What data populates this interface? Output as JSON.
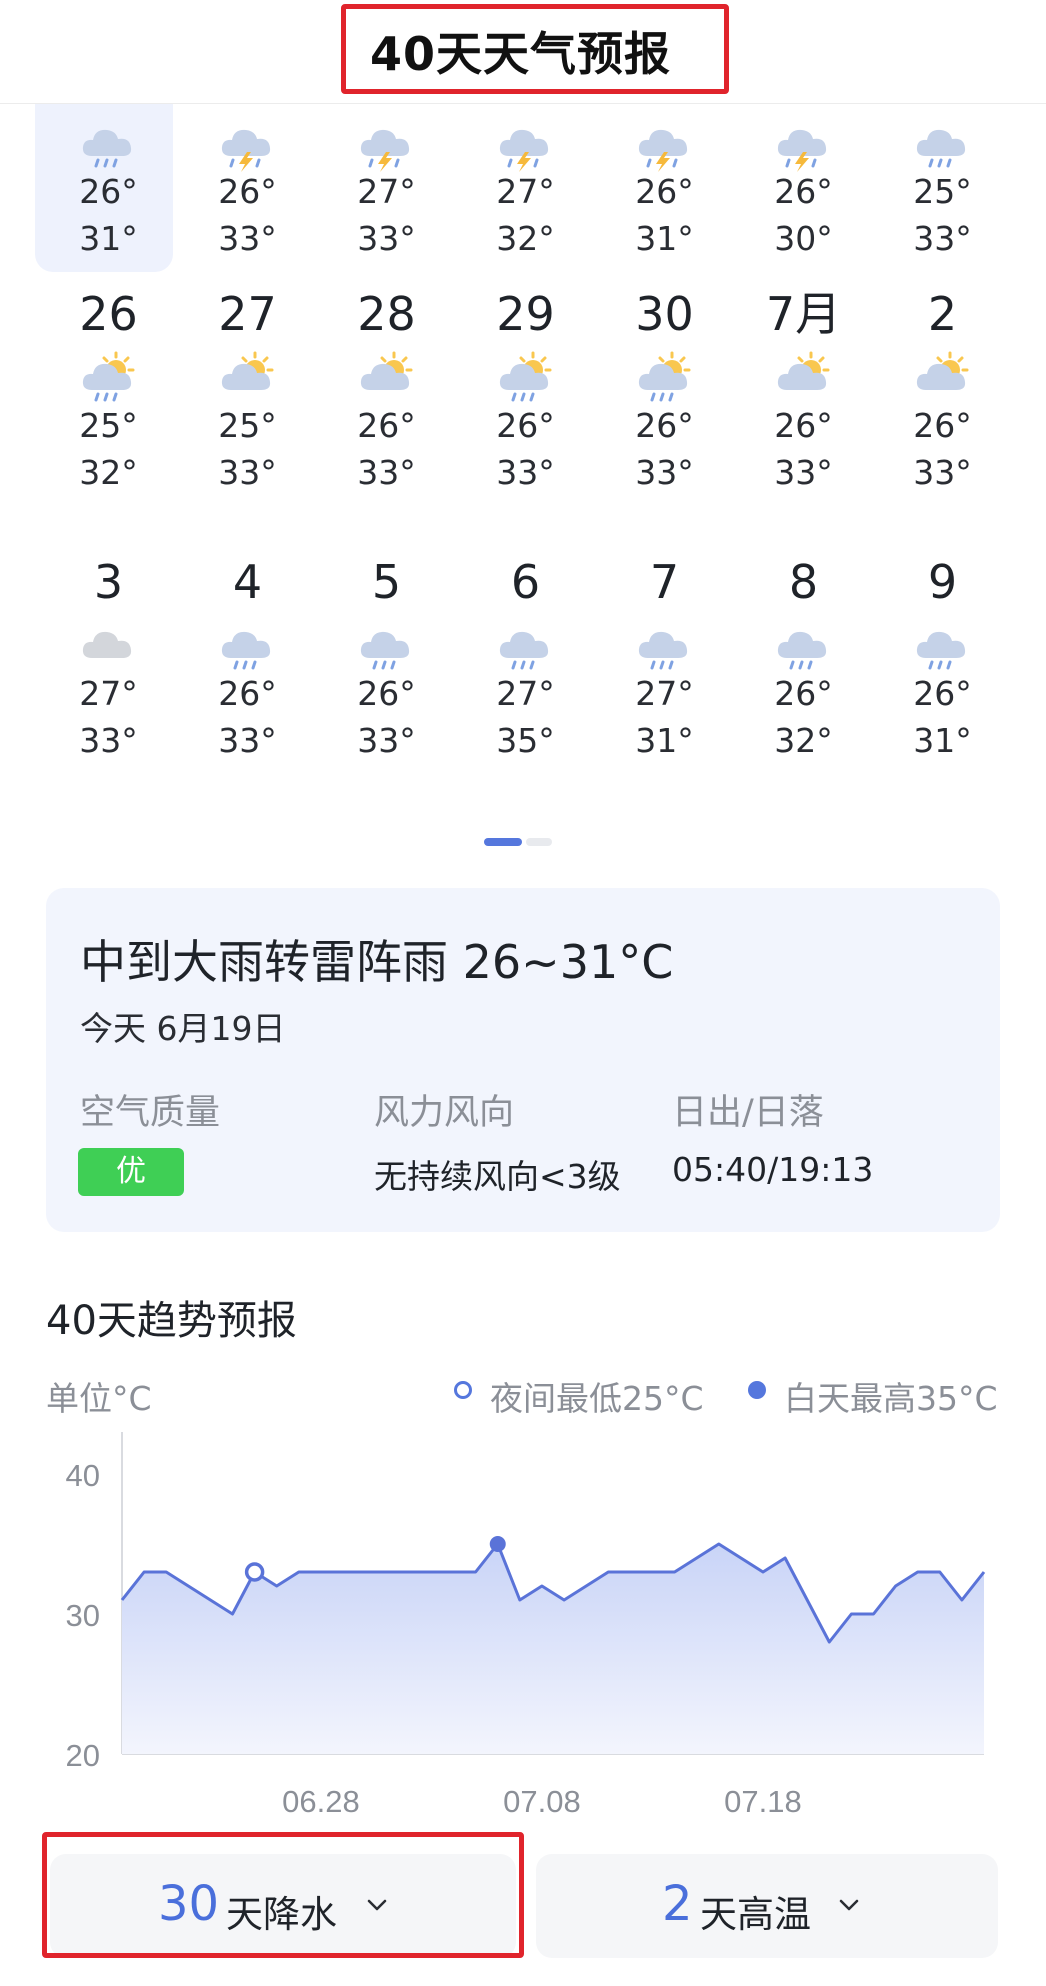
{
  "header": {
    "title": "40天天气预报"
  },
  "calendar": {
    "rows": [
      {
        "cells": [
          {
            "date": "",
            "icon": "rain-icon",
            "low": "26°",
            "high": "31°"
          },
          {
            "date": "",
            "icon": "thunder-rain-icon",
            "low": "26°",
            "high": "33°"
          },
          {
            "date": "",
            "icon": "thunder-rain-icon",
            "low": "27°",
            "high": "33°"
          },
          {
            "date": "",
            "icon": "thunder-rain-icon",
            "low": "27°",
            "high": "32°"
          },
          {
            "date": "",
            "icon": "thunder-rain-icon",
            "low": "26°",
            "high": "31°"
          },
          {
            "date": "",
            "icon": "thunder-rain-icon",
            "low": "26°",
            "high": "30°"
          },
          {
            "date": "",
            "icon": "rain-icon",
            "low": "25°",
            "high": "33°"
          }
        ]
      },
      {
        "cells": [
          {
            "date": "26",
            "icon": "sun-cloud-rain-icon",
            "low": "25°",
            "high": "32°"
          },
          {
            "date": "27",
            "icon": "partly-cloudy-icon",
            "low": "25°",
            "high": "33°"
          },
          {
            "date": "28",
            "icon": "partly-cloudy-icon",
            "low": "26°",
            "high": "33°"
          },
          {
            "date": "29",
            "icon": "sun-cloud-rain-icon",
            "low": "26°",
            "high": "33°"
          },
          {
            "date": "30",
            "icon": "sun-cloud-rain-icon",
            "low": "26°",
            "high": "33°"
          },
          {
            "date": "7月",
            "icon": "partly-cloudy-icon",
            "low": "26°",
            "high": "33°"
          },
          {
            "date": "2",
            "icon": "partly-cloudy-icon",
            "low": "26°",
            "high": "33°"
          }
        ]
      },
      {
        "cells": [
          {
            "date": "3",
            "icon": "cloudy-icon",
            "low": "27°",
            "high": "33°"
          },
          {
            "date": "4",
            "icon": "rain-icon",
            "low": "26°",
            "high": "33°"
          },
          {
            "date": "5",
            "icon": "rain-icon",
            "low": "26°",
            "high": "33°"
          },
          {
            "date": "6",
            "icon": "rain-icon",
            "low": "27°",
            "high": "35°"
          },
          {
            "date": "7",
            "icon": "rain-icon",
            "low": "27°",
            "high": "31°"
          },
          {
            "date": "8",
            "icon": "rain-icon",
            "low": "26°",
            "high": "32°"
          },
          {
            "date": "9",
            "icon": "rain-icon",
            "low": "26°",
            "high": "31°"
          }
        ]
      }
    ]
  },
  "today": {
    "condition": "中到大雨转雷阵雨 26~31°C",
    "date": "今天 6月19日",
    "aqi_label": "空气质量",
    "aqi_value": "优",
    "wind_label": "风力风向",
    "wind_value": "无持续风向<3级",
    "sun_label": "日出/日落",
    "sun_value": "05:40/19:13"
  },
  "trend": {
    "title": "40天趋势预报",
    "unit": "单位°C",
    "legend_low": "夜间最低25°C",
    "legend_high": "白天最高35°C"
  },
  "chart_data": {
    "type": "area",
    "ylim": [
      20,
      43
    ],
    "yticks": [
      "40",
      "30",
      "20"
    ],
    "xtick_labels": [
      "06.28",
      "07.08",
      "07.18"
    ],
    "xtick_index": [
      9,
      19,
      29
    ],
    "values": [
      31,
      33,
      33,
      32,
      31,
      30,
      33,
      32,
      33,
      33,
      33,
      33,
      33,
      33,
      33,
      33,
      33,
      35,
      31,
      32,
      31,
      32,
      33,
      33,
      33,
      33,
      34,
      35,
      34,
      33,
      34,
      31,
      28,
      30,
      30,
      32,
      33,
      33,
      31,
      33
    ],
    "low_marker_index": 6,
    "high_marker_index": 17,
    "colors": {
      "line": "#5a73d8",
      "fill_top": "#c9d4f7",
      "fill_bottom": "#f3f5fd",
      "axis": "#d9dbe0",
      "tick": "#8b8f97"
    }
  },
  "footer": {
    "rain_count": "30",
    "rain_label": "天降水",
    "hot_count": "2",
    "hot_label": "天高温"
  }
}
